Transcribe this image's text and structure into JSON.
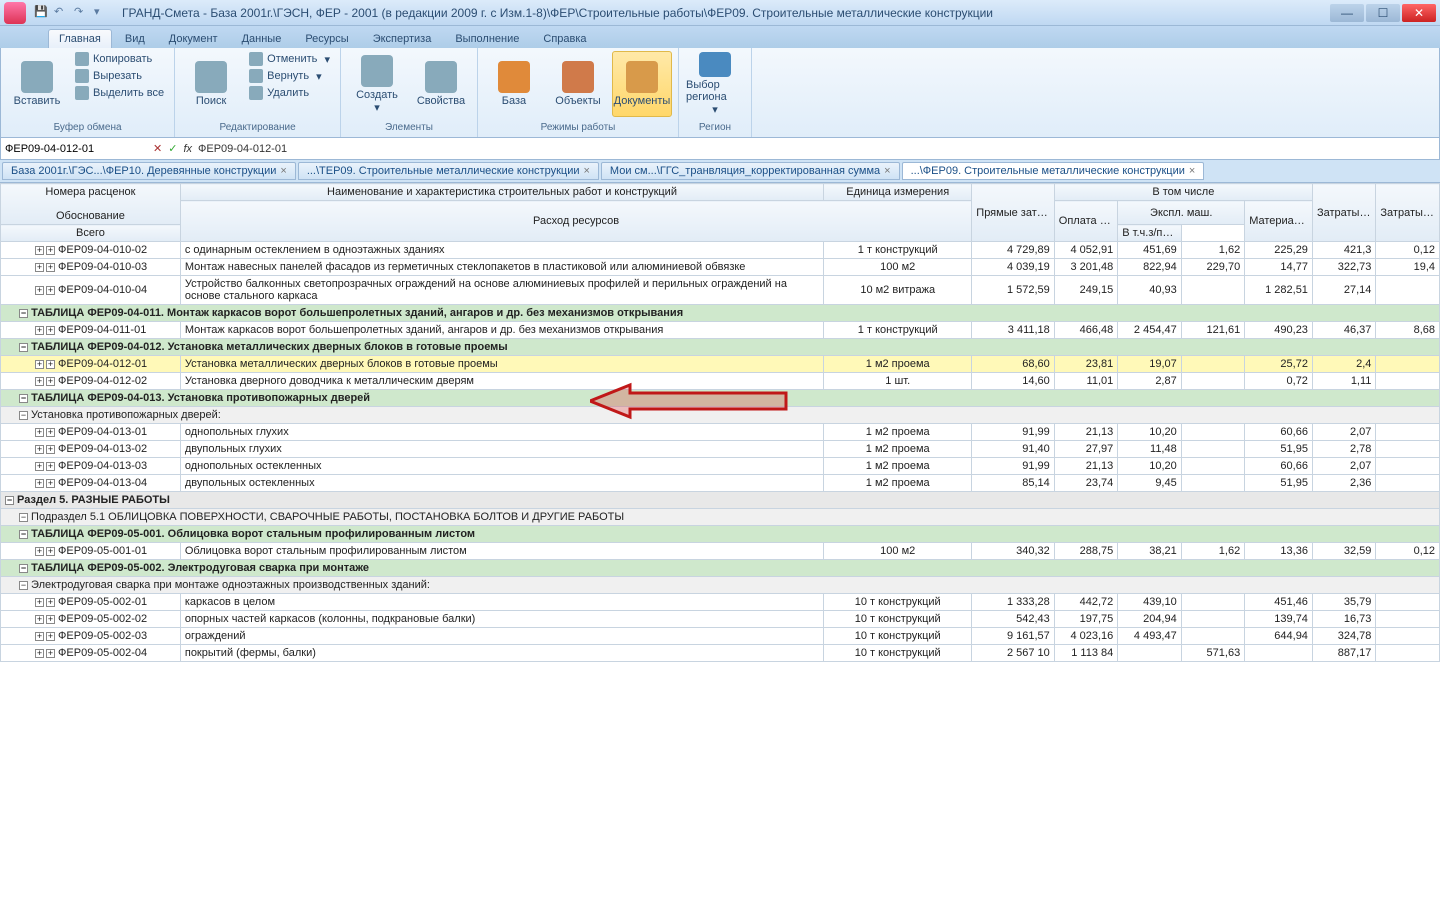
{
  "title": "ГРАНД-Смета - База 2001г.\\ГЭСН, ФЕР - 2001 (в редакции 2009 г. с Изм.1-8)\\ФЕР\\Строительные работы\\ФЕР09. Строительные металлические конструкции",
  "tabs": [
    "Главная",
    "Вид",
    "Документ",
    "Данные",
    "Ресурсы",
    "Экспертиза",
    "Выполнение",
    "Справка"
  ],
  "ribbon": {
    "paste": "Вставить",
    "copy": "Копировать",
    "cut": "Вырезать",
    "selall": "Выделить все",
    "g1": "Буфер обмена",
    "search": "Поиск",
    "undo": "Отменить",
    "redo": "Вернуть",
    "del": "Удалить",
    "g2": "Редактирование",
    "create": "Создать",
    "props": "Свойства",
    "g3": "Элементы",
    "base": "База",
    "objects": "Объекты",
    "docs": "Документы",
    "g4": "Режимы работы",
    "region": "Выбор региона",
    "g5": "Регион"
  },
  "formula": {
    "cell": "ФЕР09-04-012-01",
    "fx": "fx",
    "val": "ФЕР09-04-012-01"
  },
  "doctabs": [
    "База 2001г.\\ГЭС...\\ФЕР10. Деревянные конструкции",
    "...\\ТЕР09. Строительные металлические конструкции",
    "Мои см...\\ГГС_транвляция_корректированная сумма",
    "...\\ФЕР09. Строительные металлические конструкции"
  ],
  "hdr": {
    "num": "Номера расценок",
    "obo": "Обоснование",
    "name": "Наименование и характеристика строительных работ и конструкций",
    "eu": "Единица измерения",
    "rr": "Расход ресурсов",
    "pz": "Прямые затраты",
    "vtc": "В том числе",
    "otr": "Оплата труда рабочих",
    "em": "Экспл. маш.",
    "vs": "Всего",
    "vt": "В т.ч.з/пл маш-тов",
    "mat": "Материалы",
    "ztr": "Затраты труда рабочих",
    "ztm": "Затраты труда маш-стов"
  },
  "rows": [
    {
      "t": "d",
      "code": "ФЕР09-04-010-02",
      "name": "с одинарным остеклением в одноэтажных зданиях",
      "unit": "1 т конструкций",
      "v": [
        "4 729,89",
        "4 052,91",
        "451,69",
        "1,62",
        "225,29",
        "421,3",
        "0,12"
      ]
    },
    {
      "t": "d",
      "code": "ФЕР09-04-010-03",
      "name": "Монтаж навесных панелей фасадов из герметичных стеклопакетов в пластиковой или алюминиевой обвязке",
      "unit": "100 м2",
      "v": [
        "4 039,19",
        "3 201,48",
        "822,94",
        "229,70",
        "14,77",
        "322,73",
        "19,4"
      ]
    },
    {
      "t": "d",
      "code": "ФЕР09-04-010-04",
      "name": "Устройство балконных светопрозрачных ограждений на основе алюминиевых профилей и перильных ограждений на основе стального каркаса",
      "unit": "10 м2 витража",
      "v": [
        "1 572,59",
        "249,15",
        "40,93",
        "",
        "1 282,51",
        "27,14",
        ""
      ]
    },
    {
      "t": "h",
      "name": "ТАБЛИЦА ФЕР09-04-011. Монтаж каркасов ворот большепролетных зданий, ангаров и др. без механизмов открывания"
    },
    {
      "t": "d",
      "code": "ФЕР09-04-011-01",
      "name": "Монтаж каркасов ворот большепролетных зданий, ангаров и др. без механизмов открывания",
      "unit": "1 т конструкций",
      "v": [
        "3 411,18",
        "466,48",
        "2 454,47",
        "121,61",
        "490,23",
        "46,37",
        "8,68"
      ]
    },
    {
      "t": "h",
      "name": "ТАБЛИЦА ФЕР09-04-012. Установка металлических дверных блоков в готовые проемы"
    },
    {
      "t": "s",
      "code": "ФЕР09-04-012-01",
      "name": "Установка металлических дверных блоков в готовые проемы",
      "unit": "1 м2 проема",
      "v": [
        "68,60",
        "23,81",
        "19,07",
        "",
        "25,72",
        "2,4",
        ""
      ]
    },
    {
      "t": "d",
      "code": "ФЕР09-04-012-02",
      "name": "Установка дверного доводчика к металлическим дверям",
      "unit": "1 шт.",
      "v": [
        "14,60",
        "11,01",
        "2,87",
        "",
        "0,72",
        "1,11",
        ""
      ]
    },
    {
      "t": "h",
      "name": "ТАБЛИЦА ФЕР09-04-013. Установка противопожарных дверей"
    },
    {
      "t": "sub",
      "name": "Установка противопожарных дверей:"
    },
    {
      "t": "d",
      "code": "ФЕР09-04-013-01",
      "name": "однопольных глухих",
      "unit": "1 м2 проема",
      "v": [
        "91,99",
        "21,13",
        "10,20",
        "",
        "60,66",
        "2,07",
        ""
      ]
    },
    {
      "t": "d",
      "code": "ФЕР09-04-013-02",
      "name": "двупольных глухих",
      "unit": "1 м2 проема",
      "v": [
        "91,40",
        "27,97",
        "11,48",
        "",
        "51,95",
        "2,78",
        ""
      ]
    },
    {
      "t": "d",
      "code": "ФЕР09-04-013-03",
      "name": "однопольных остекленных",
      "unit": "1 м2 проема",
      "v": [
        "91,99",
        "21,13",
        "10,20",
        "",
        "60,66",
        "2,07",
        ""
      ]
    },
    {
      "t": "d",
      "code": "ФЕР09-04-013-04",
      "name": "двупольных остекленных",
      "unit": "1 м2 проема",
      "v": [
        "85,14",
        "23,74",
        "9,45",
        "",
        "51,95",
        "2,36",
        ""
      ]
    },
    {
      "t": "sec",
      "name": "Раздел 5. РАЗНЫЕ РАБОТЫ"
    },
    {
      "t": "sub",
      "name": "Подраздел 5.1 ОБЛИЦОВКА ПОВЕРХНОСТИ, СВАРОЧНЫЕ РАБОТЫ, ПОСТАНОВКА БОЛТОВ И ДРУГИЕ РАБОТЫ"
    },
    {
      "t": "h",
      "name": "ТАБЛИЦА ФЕР09-05-001. Облицовка ворот стальным профилированным листом"
    },
    {
      "t": "d",
      "code": "ФЕР09-05-001-01",
      "name": "Облицовка ворот стальным профилированным листом",
      "unit": "100 м2",
      "v": [
        "340,32",
        "288,75",
        "38,21",
        "1,62",
        "13,36",
        "32,59",
        "0,12"
      ]
    },
    {
      "t": "h",
      "name": "ТАБЛИЦА ФЕР09-05-002. Электродуговая сварка при монтаже"
    },
    {
      "t": "sub",
      "name": "Электродуговая сварка при монтаже одноэтажных производственных зданий:"
    },
    {
      "t": "d",
      "code": "ФЕР09-05-002-01",
      "name": "каркасов в целом",
      "unit": "10 т конструкций",
      "v": [
        "1 333,28",
        "442,72",
        "439,10",
        "",
        "451,46",
        "35,79",
        ""
      ]
    },
    {
      "t": "d",
      "code": "ФЕР09-05-002-02",
      "name": "опорных частей каркасов (колонны, подкрановые балки)",
      "unit": "10 т конструкций",
      "v": [
        "542,43",
        "197,75",
        "204,94",
        "",
        "139,74",
        "16,73",
        ""
      ]
    },
    {
      "t": "d",
      "code": "ФЕР09-05-002-03",
      "name": "ограждений",
      "unit": "10 т конструкций",
      "v": [
        "9 161,57",
        "4 023,16",
        "4 493,47",
        "",
        "644,94",
        "324,78",
        ""
      ]
    },
    {
      "t": "d",
      "code": "ФЕР09-05-002-04",
      "name": "покрытий (фермы, балки)",
      "unit": "10 т конструкций",
      "v": [
        "2 567 10",
        "1 113 84",
        "",
        "571,63",
        "",
        "887,17",
        ""
      ]
    }
  ]
}
